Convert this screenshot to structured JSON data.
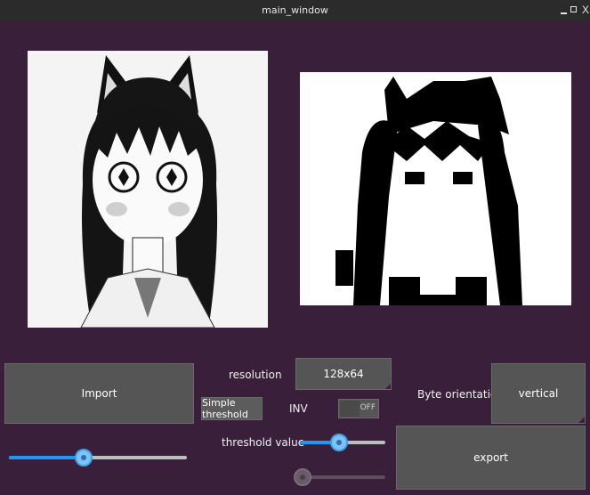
{
  "window": {
    "title": "main_window"
  },
  "controls": {
    "import_label": "Import",
    "resolution_label": "resolution",
    "resolution_value": "128x64",
    "simple_threshold_label": "Simple threshold",
    "inv_label": "INV",
    "inv_state": "OFF",
    "byte_orientation_label": "Byte orientation",
    "byte_orientation_value": "vertical",
    "threshold_value_label": "threshold value",
    "export_label": "export"
  },
  "sliders": {
    "main": {
      "value": 0.42
    },
    "threshold": {
      "value": 0.46
    },
    "secondary": {
      "value": 0.0
    }
  },
  "images": {
    "original": "anime-girl-original-icon",
    "preview": "anime-girl-threshold-preview-icon"
  },
  "colors": {
    "background": "#3a1f3a",
    "button": "#555555",
    "accent": "#2196f3"
  }
}
